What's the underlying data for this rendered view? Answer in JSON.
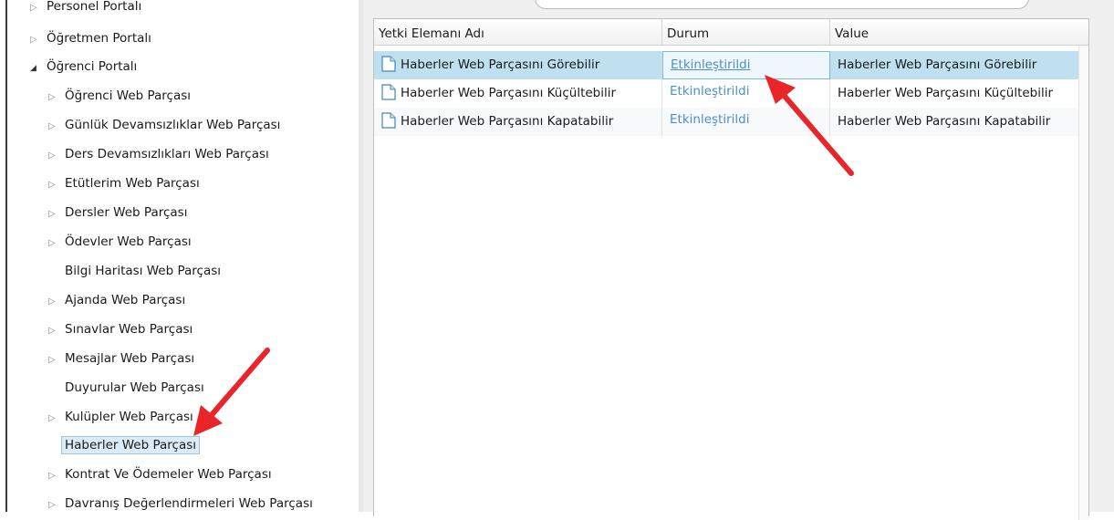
{
  "tree": {
    "items": [
      {
        "label": "Personel Portalı",
        "arrow": "▷"
      },
      {
        "label": "Öğretmen Portalı",
        "arrow": "▷"
      },
      {
        "label": "Öğrenci Portalı",
        "arrow": "◢"
      },
      {
        "label": "Öğrenci Web Parçası",
        "arrow": "▷"
      },
      {
        "label": "Günlük Devamsızlıklar Web Parçası",
        "arrow": "▷"
      },
      {
        "label": "Ders Devamsızlıkları Web Parçası",
        "arrow": "▷"
      },
      {
        "label": "Etütlerim Web Parçası",
        "arrow": "▷"
      },
      {
        "label": "Dersler Web Parçası",
        "arrow": "▷"
      },
      {
        "label": "Ödevler Web Parçası",
        "arrow": "▷"
      },
      {
        "label": "Bilgi Haritası Web Parçası",
        "arrow": ""
      },
      {
        "label": "Ajanda Web Parçası",
        "arrow": "▷"
      },
      {
        "label": "Sınavlar Web Parçası",
        "arrow": "▷"
      },
      {
        "label": "Mesajlar Web Parçası",
        "arrow": "▷"
      },
      {
        "label": "Duyurular Web Parçası",
        "arrow": ""
      },
      {
        "label": "Kulüpler Web Parçası",
        "arrow": "▷"
      },
      {
        "label": "Haberler Web Parçası",
        "arrow": ""
      },
      {
        "label": "Kontrat Ve Ödemeler Web Parçası",
        "arrow": "▷"
      },
      {
        "label": "Davranış Değerlendirmeleri Web Parçası",
        "arrow": "▷"
      }
    ],
    "selected_index": 15
  },
  "grid": {
    "headers": {
      "name": "Yetki Elemanı Adı",
      "status": "Durum",
      "value": "Value"
    },
    "rows": [
      {
        "name": "Haberler Web Parçasını Görebilir",
        "status": "Etkinleştirildi",
        "value": "Haberler Web Parçasını Görebilir"
      },
      {
        "name": "Haberler Web Parçasını Küçültebilir",
        "status": "Etkinleştirildi",
        "value": "Haberler Web Parçasını Küçültebilir"
      },
      {
        "name": "Haberler Web Parçasını Kapatabilir",
        "status": "Etkinleştirildi",
        "value": "Haberler Web Parçasını Kapatabilir"
      }
    ],
    "selected_row": 0
  },
  "colors": {
    "annotation_arrow": "#e8262a",
    "link": "#4a90c8",
    "selected_row_bg": "#bfe0ef"
  }
}
